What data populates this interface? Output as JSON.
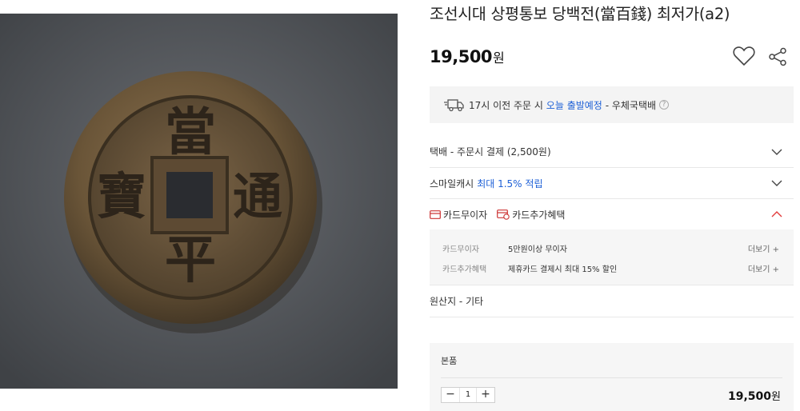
{
  "product": {
    "title": "조선시대 상평통보 당백전(當百錢) 최저가(a2)",
    "price": "19,500",
    "currency_unit": "원",
    "image_characters": [
      "當",
      "通",
      "平",
      "寶"
    ]
  },
  "shipping": {
    "cutoff_text": "17시 이전 주문 시",
    "eta_highlight": "오늘 출발예정",
    "carrier": "- 우체국택배",
    "help": "?"
  },
  "delivery_fee": {
    "label": "택배 - 주문시 결제 (2,500원)"
  },
  "smile_cash": {
    "label": "스마일캐시",
    "benefit": "최대 1.5% 적립"
  },
  "card_tabs": [
    {
      "label": "카드무이자"
    },
    {
      "label": "카드추가혜택"
    }
  ],
  "card_details": [
    {
      "label": "카드무이자",
      "value": "5만원이상 무이자",
      "more": "더보기 +"
    },
    {
      "label": "카드추가혜택",
      "value": "제휴카드 결제시 최대 15% 할인",
      "more": "더보기 +"
    }
  ],
  "origin": {
    "label": "원산지 - 기타"
  },
  "option": {
    "name": "본품",
    "minus": "−",
    "plus": "+",
    "quantity": "1",
    "price": "19,500",
    "currency_unit": "원"
  },
  "colors": {
    "accent_blue": "#1c5fd6",
    "chevron_up_red": "#e23b3b"
  }
}
